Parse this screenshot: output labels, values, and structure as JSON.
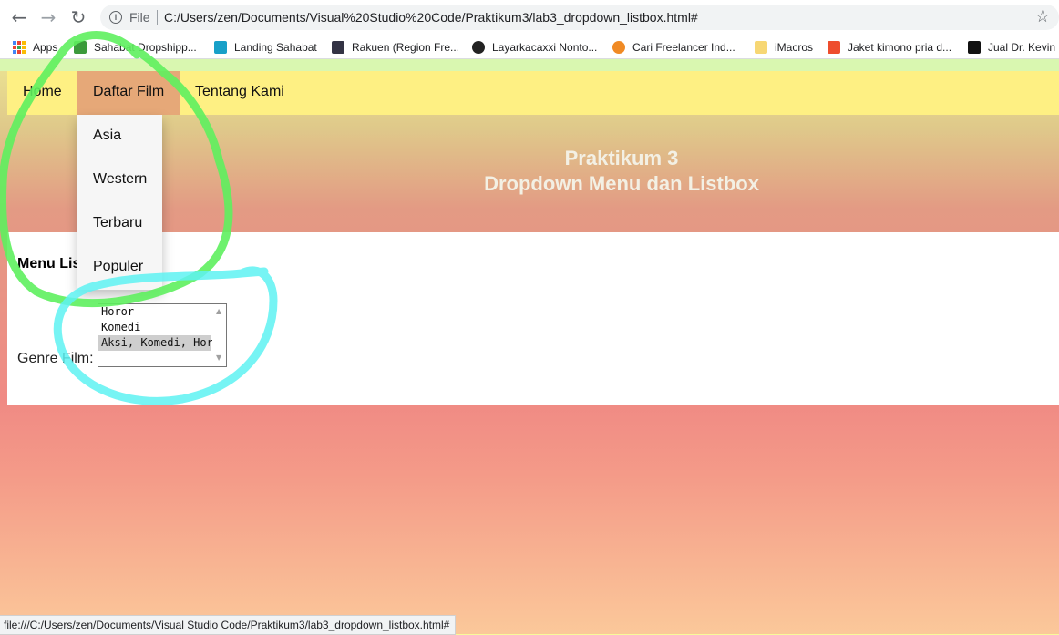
{
  "browser": {
    "file_label": "File",
    "url": "C:/Users/zen/Documents/Visual%20Studio%20Code/Praktikum3/lab3_dropdown_listbox.html#",
    "back_icon": "back-arrow-icon",
    "forward_icon": "forward-arrow-icon",
    "reload_icon": "reload-icon",
    "star_icon": "bookmark-star-icon",
    "bookmarks": [
      {
        "label": "Apps",
        "color": "#4285f4"
      },
      {
        "label": "Sahabat Dropshipp...",
        "color": "#3c9a3c"
      },
      {
        "label": "Landing Sahabat",
        "color": "#18a0c8"
      },
      {
        "label": "Rakuen (Region Fre...",
        "color": "#334"
      },
      {
        "label": "Layarkacaxxi Nonto...",
        "color": "#222"
      },
      {
        "label": "Cari Freelancer Ind...",
        "color": "#f08a24"
      },
      {
        "label": "iMacros",
        "color": "#f7d774"
      },
      {
        "label": "Jaket kimono pria d...",
        "color": "#ee4d2d"
      },
      {
        "label": "Jual Dr. Kevin I",
        "color": "#111"
      }
    ],
    "status_url": "file:///C:/Users/zen/Documents/Visual Studio Code/Praktikum3/lab3_dropdown_listbox.html#"
  },
  "nav": {
    "items": [
      {
        "label": "Home",
        "active": false
      },
      {
        "label": "Daftar Film",
        "active": true
      },
      {
        "label": "Tentang Kami",
        "active": false
      }
    ],
    "dropdown": [
      "Asia",
      "Western",
      "Terbaru",
      "Populer"
    ]
  },
  "header": {
    "line1": "Praktikum 3",
    "line2": "Dropdown Menu dan Listbox"
  },
  "content": {
    "heading": "Menu Lis",
    "genre_label": "Genre Film:",
    "listbox_options": [
      {
        "label": "Horor",
        "selected": false
      },
      {
        "label": "Komedi",
        "selected": false
      },
      {
        "label": "Aksi, Komedi, Horor",
        "selected": true
      }
    ]
  },
  "colors": {
    "navbar": "#fef083",
    "nav_active": "#e6a878",
    "annotation_green": "#5ef05e",
    "annotation_cyan": "#5ef2f2"
  }
}
